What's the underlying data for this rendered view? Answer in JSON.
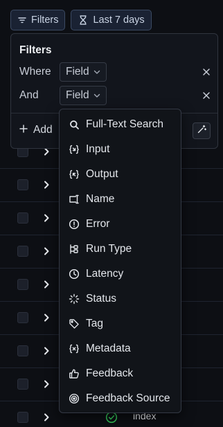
{
  "toolbar": {
    "filters_label": "Filters",
    "date_range_label": "Last 7 days"
  },
  "filters_panel": {
    "title": "Filters",
    "rows": [
      {
        "conjunction": "Where",
        "field": "Field"
      },
      {
        "conjunction": "And",
        "field": "Field"
      }
    ],
    "add_label": "Add"
  },
  "field_menu": {
    "items": [
      {
        "label": "Full-Text Search",
        "icon": "search-icon"
      },
      {
        "label": "Input",
        "icon": "input-icon"
      },
      {
        "label": "Output",
        "icon": "output-icon"
      },
      {
        "label": "Name",
        "icon": "name-icon"
      },
      {
        "label": "Error",
        "icon": "error-icon"
      },
      {
        "label": "Run Type",
        "icon": "run-type-icon"
      },
      {
        "label": "Latency",
        "icon": "clock-icon"
      },
      {
        "label": "Status",
        "icon": "status-loader-icon"
      },
      {
        "label": "Tag",
        "icon": "tag-icon"
      },
      {
        "label": "Metadata",
        "icon": "metadata-icon"
      },
      {
        "label": "Feedback",
        "icon": "thumbs-up-icon"
      },
      {
        "label": "Feedback Source",
        "icon": "target-icon"
      }
    ]
  },
  "table": {
    "last_row_name": "index",
    "success_color": "#34c759"
  }
}
